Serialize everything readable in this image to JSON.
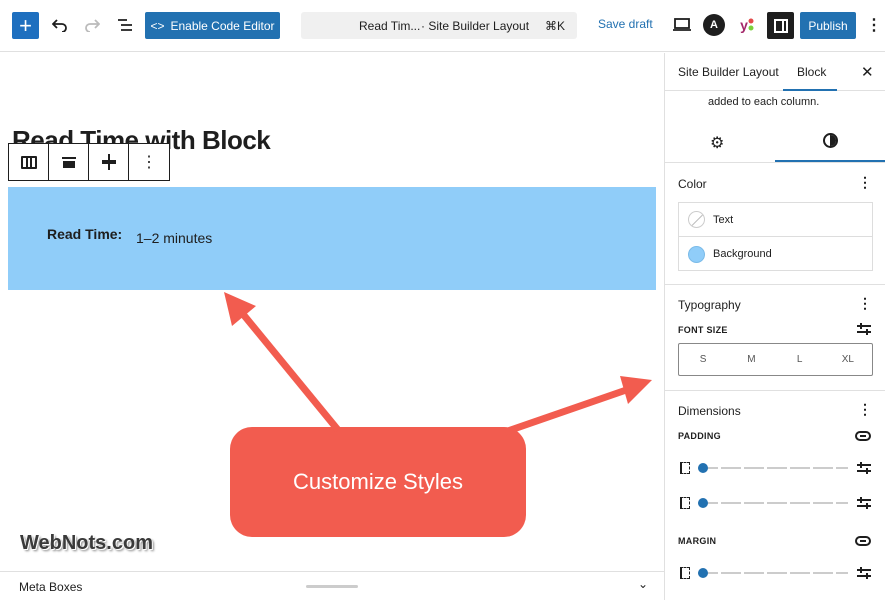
{
  "toolbar": {
    "add_icon": "plus-icon",
    "undo_icon": "undo-icon",
    "redo_icon": "redo-icon",
    "list_view_icon": "list-view-icon",
    "code_editor_label": "Enable Code Editor",
    "document_title": "Read Tim...",
    "document_separator": "· Site Builder Layout",
    "shortcut": "⌘K",
    "save_draft_label": "Save draft",
    "astra_letter": "A",
    "yoast_letter": "y",
    "publish_label": "Publish",
    "more_label": "⋮"
  },
  "canvas": {
    "page_title": "Read Time with Block",
    "block_toolbar_more": "⋮",
    "read_time_label": "Read Time:",
    "read_time_value": "1–2 minutes",
    "callout_text": "Customize Styles",
    "watermark": "WebNots.com"
  },
  "metabar": {
    "label": "Meta Boxes",
    "chevron": "⌄"
  },
  "sidebar": {
    "tab_document": "Site Builder Layout",
    "tab_block": "Block",
    "close": "✕",
    "note": "added to each column.",
    "settings_icon": "⚙",
    "color": {
      "title": "Color",
      "more": "⋮",
      "text_label": "Text",
      "background_label": "Background",
      "background_color": "#90cdf9"
    },
    "typography": {
      "title": "Typography",
      "more": "⋮",
      "font_size_label": "FONT SIZE",
      "sizes": [
        "S",
        "M",
        "L",
        "XL"
      ]
    },
    "dimensions": {
      "title": "Dimensions",
      "more": "⋮",
      "padding_label": "PADDING",
      "margin_label": "MARGIN"
    }
  },
  "colors": {
    "accent": "#2271b1",
    "block_bg": "#90cdf9",
    "callout": "#f25c4f"
  }
}
